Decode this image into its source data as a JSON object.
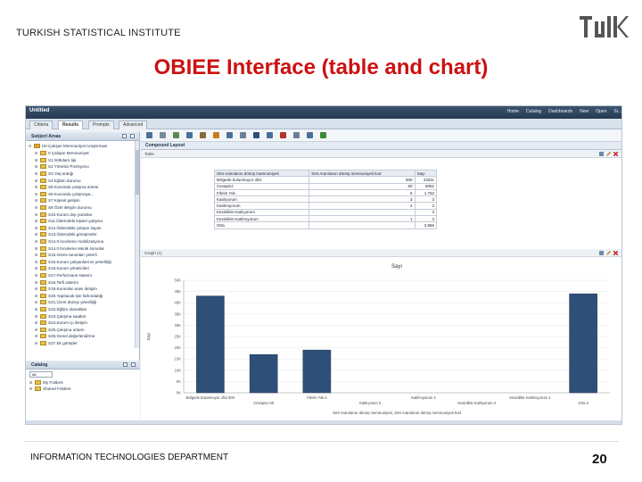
{
  "slide": {
    "org": "TURKISH STATISTICAL INSTITUTE",
    "logo_text": "TÜİK",
    "title": "OBIEE Interface (table and chart)",
    "footer_left": "INFORMATION TECHNOLOGIES DEPARTMENT",
    "page_number": "20",
    "title_color": "#cc1111"
  },
  "app": {
    "document_title": "Untitled",
    "topnav": [
      "Home",
      "Catalog",
      "Dashboards",
      "New",
      "Open",
      "Si..."
    ],
    "tabs": [
      "Criteria",
      "Results",
      "Prompts",
      "Advanced"
    ],
    "active_tab": "Results",
    "toolbar_icons": [
      "save-icon",
      "print-icon",
      "export-icon",
      "refresh-icon",
      "undo-icon",
      "edit-icon",
      "filter-icon",
      "sort-icon",
      "chart-icon",
      "table-icon",
      "delete-icon",
      "settings-icon",
      "pivot-icon",
      "run-icon"
    ]
  },
  "subject_areas": {
    "header": "Subject Areas",
    "root": "ISI-Çalışan Memnuniyet Araştırması",
    "items": [
      "0 Çalışan Memnuniyet",
      "S1 İstihdam tipi",
      "S2 Yönetici Pozisyonu",
      "S3 Yaş aralığı",
      "S4 Eğitim durumu",
      "S5 Kurumda çalışma süresi",
      "S6 Kurumda çalışmaya...",
      "S7 Kişisel gelişim",
      "S8 Özel iletişim durumu",
      "S10.Kurum dışı yazarlar",
      "S11.Ödemdeki kişisel çalışma",
      "S12.Ödemdeki çalışan sayısı",
      "S13.Ödemdeki görüşmeler",
      "S14.0 İnceleme mobilizasyonu",
      "S14.0 İnceleme teknik sorunlar",
      "S15.Görev tanımları yeterli",
      "S16.Kurum çalışanlarının yeterliliği",
      "S16.Kurum yöneticileri",
      "S17.Performans sistemi",
      "S18.Terfi sistemi",
      "S19.Kurumlar arası iletişim",
      "S20.Yapılacak işin farkındalığı",
      "S21.Ücret düzeyi yeterliliği",
      "S22.Eğitim olanakları",
      "S23.Çalışma saatleri",
      "S24.Kurum içi iletişim",
      "S25.Çalışma ortamı",
      "S26.Genel değerlendirme",
      "S27.Ek görüşler"
    ]
  },
  "catalog": {
    "header": "Catalog",
    "search_value": "All",
    "items": [
      "My Folders",
      "Shared Folders"
    ]
  },
  "compound_layout": {
    "header": "Compound Layout",
    "table_view_title": "Table",
    "graph_view_title": "Graph (1)",
    "table_columns": [
      "S04 Aranılanın dönüş mamnuniyeti",
      "S04 Aranılanın dönüş memnuniyeti kod",
      "Sayı"
    ],
    "table_rows": [
      [
        "Bölgede bulunmuyor ofisi",
        "600",
        "43311"
      ],
      [
        "Cevapsız",
        "60",
        "6062"
      ],
      [
        "Fikrim Yok",
        "6",
        "1.752"
      ],
      [
        "Katılıyorum",
        "3",
        "3"
      ],
      [
        "Katılmıyorum",
        "4",
        "3"
      ],
      [
        "Kesinlikle Katılıyorum",
        "",
        "3"
      ],
      [
        "Kesinlikle Katılmıyorum",
        "1",
        "3"
      ],
      [
        "Orta",
        "",
        "3.866"
      ]
    ]
  },
  "chart_data": {
    "type": "bar",
    "title": "Sayı",
    "ylabel": "Sayı",
    "xlabel": "S04 Aranılanın dönüş memnuniyeti, S04 Aranılanın dönüş memnuniyeti kod",
    "categories": [
      "Bölgede bulunmuyor ofisi 600",
      "Cevapsız 60",
      "Fikrim Yok 6",
      "Katılıyorum 2",
      "Katılmıyorum 4",
      "Kesinlikle Katılıyorum 3",
      "Kesinlikle Katılmıyorum 1",
      "Orta 3"
    ],
    "values": [
      43000,
      17000,
      19000,
      0,
      0,
      0,
      0,
      44000
    ],
    "yticks": [
      "0K",
      "5K",
      "10K",
      "15K",
      "20K",
      "25K",
      "30K",
      "35K",
      "40K",
      "45K",
      "50K"
    ],
    "ylim": [
      0,
      50000
    ],
    "bar_color": "#2e4f78",
    "grid": true
  }
}
